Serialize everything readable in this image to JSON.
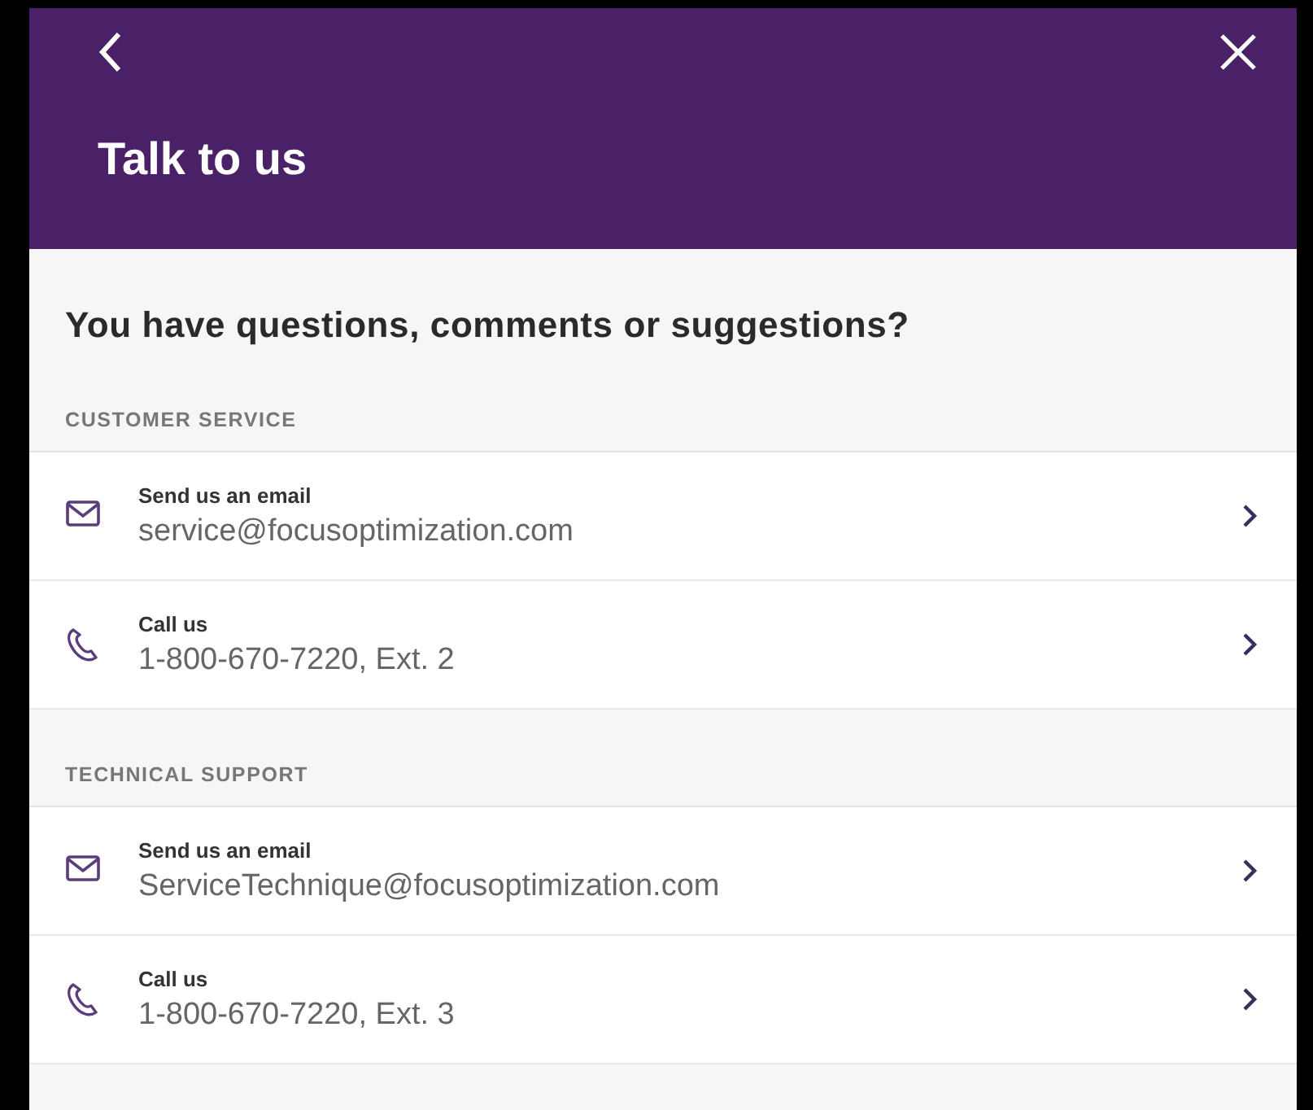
{
  "header": {
    "title": "Talk to us"
  },
  "heading": "You have questions, comments or suggestions?",
  "sections": [
    {
      "label": "CUSTOMER SERVICE",
      "items": [
        {
          "kind": "email",
          "title": "Send us an email",
          "value": "service@focusoptimization.com"
        },
        {
          "kind": "phone",
          "title": "Call us",
          "value": "1-800-670-7220, Ext. 2"
        }
      ]
    },
    {
      "label": "TECHNICAL SUPPORT",
      "items": [
        {
          "kind": "email",
          "title": "Send us an email",
          "value": "ServiceTechnique@focusoptimization.com"
        },
        {
          "kind": "phone",
          "title": "Call us",
          "value": "1-800-670-7220, Ext. 3"
        }
      ]
    }
  ]
}
